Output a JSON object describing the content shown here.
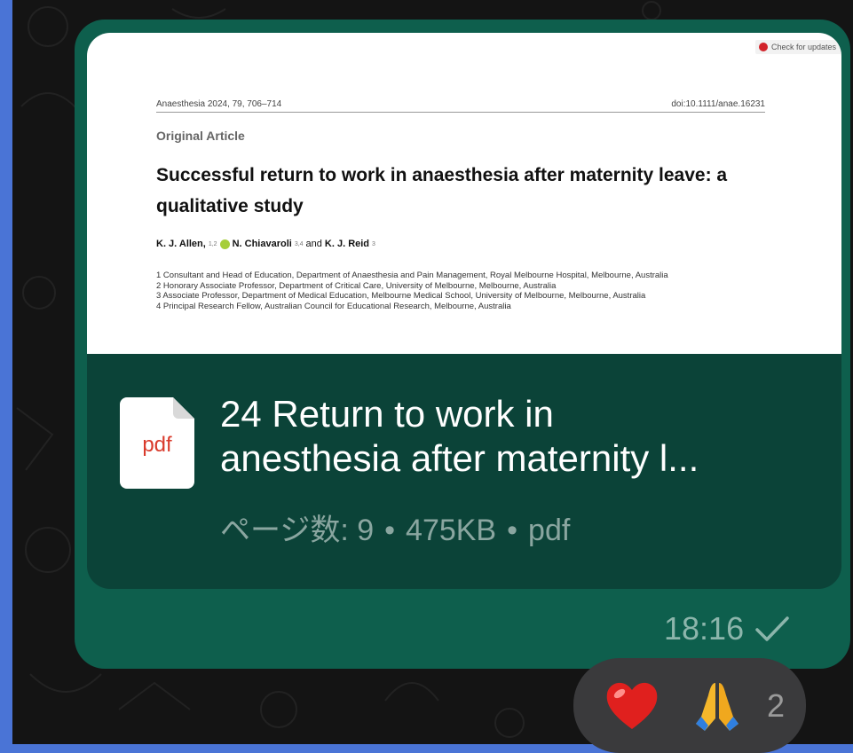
{
  "message": {
    "preview": {
      "check_updates": "Check for updates",
      "journal_ref": "Anaesthesia 2024, 79, 706–714",
      "doi": "doi:10.1111/anae.16231",
      "section": "Original Article",
      "title": "Successful return to work in anaesthesia after maternity leave: a qualitative study",
      "authors": {
        "a1": "K. J. Allen,",
        "a1_sup": "1,2",
        "a2": "N. Chiavaroli",
        "a2_sup": "3,4",
        "and": "and",
        "a3": "K. J. Reid",
        "a3_sup": "3"
      },
      "affiliations": [
        "1 Consultant and Head of Education, Department of Anaesthesia and Pain Management, Royal Melbourne Hospital, Melbourne, Australia",
        "2 Honorary Associate Professor, Department of Critical Care, University of Melbourne, Melbourne, Australia",
        "3 Associate Professor, Department of Medical Education, Melbourne Medical School, University of Melbourne, Melbourne, Australia",
        "4 Principal Research Fellow, Australian Council for Educational Research, Melbourne, Australia"
      ]
    },
    "file": {
      "icon_label": "pdf",
      "name_line1": "24 Return to work in",
      "name_line2": "anesthesia after maternity l...",
      "pages": "ページ数: 9",
      "size": "475KB",
      "type": "pdf",
      "separator": "•"
    },
    "time": "18:16",
    "status_icon": "check-icon",
    "reactions": {
      "items": [
        {
          "icon": "red-heart-icon"
        },
        {
          "icon": "folded-hands-icon"
        }
      ],
      "count": "2"
    }
  },
  "colors": {
    "bubble": "#0e5f4d",
    "card": "#0b4338",
    "background": "#141414",
    "frame": "#4a74d6",
    "pdf_red": "#d93a2b"
  }
}
